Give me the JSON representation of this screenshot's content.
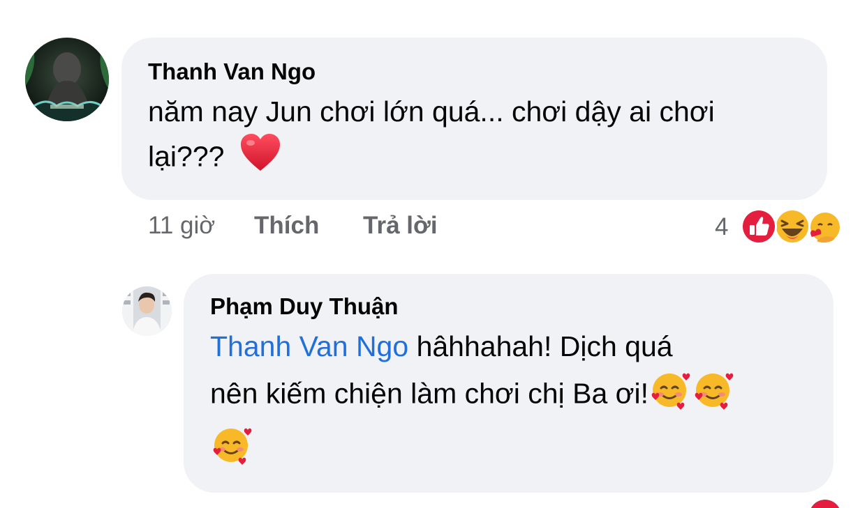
{
  "comment": {
    "author": "Thanh Van Ngo",
    "text_line1": "năm nay Jun chơi lớn quá... chơi dậy ai chơi",
    "text_line2": "lại???",
    "emoji": "red-heart",
    "time": "11 giờ",
    "like_label": "Thích",
    "reply_label": "Trả lời",
    "reaction_count": "4",
    "reactions": [
      "like",
      "haha",
      "care"
    ]
  },
  "reply": {
    "author": "Phạm Duy Thuận",
    "mention": "Thanh Van Ngo",
    "text_line1": " hâhhahah! Dịch quá",
    "text_line2": "nên kiếm chiện làm chơi chị Ba ơi!",
    "emoji": "smiling-face-with-hearts"
  },
  "colors": {
    "bubble": "#f0f2f5",
    "mention": "#216fdb",
    "meta": "#65676b",
    "heart": "#e41e3f",
    "like": "#e41e3f",
    "emoji_yellow": "#f7b928"
  }
}
